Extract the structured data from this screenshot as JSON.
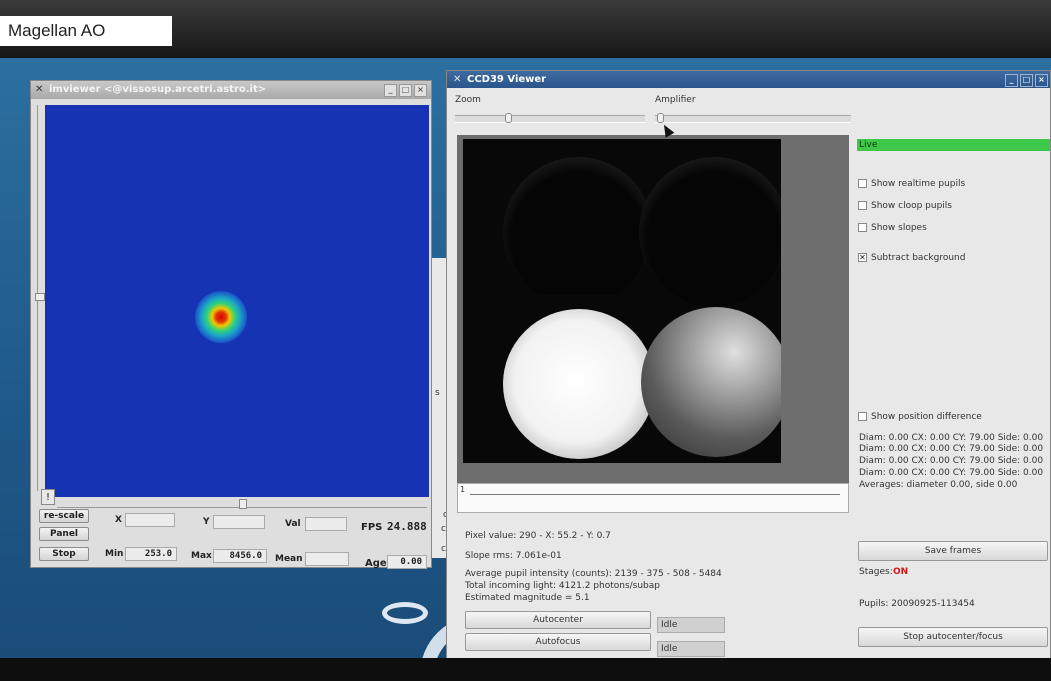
{
  "top_label": "Magellan AO",
  "imviewer": {
    "title": "imviewer <@vissosup.arcetri.astro.it>",
    "up_button": "!",
    "buttons": {
      "rescale": "re-scale",
      "panel": "Panel",
      "stop": "Stop"
    },
    "labels": {
      "x": "X",
      "y": "Y",
      "val": "Val",
      "fps": "FPS",
      "min": "Min",
      "max": "Max",
      "mean": "Mean",
      "age": "Age"
    },
    "values": {
      "fps": "24.888",
      "min": "253.0",
      "max": "8456.0",
      "age": "0.00",
      "x": "",
      "y": "",
      "val": "",
      "mean": ""
    }
  },
  "background_window": {
    "fragments": [
      "s",
      "cd",
      "cus",
      "cus"
    ]
  },
  "ccd39": {
    "title": "CCD39 Viewer",
    "zoom_label": "Zoom",
    "amplifier_label": "Amplifier",
    "plot_ticks": "1",
    "live": "Live",
    "checkboxes": [
      {
        "label": "Show realtime pupils",
        "checked": ""
      },
      {
        "label": "Show cloop pupils",
        "checked": ""
      },
      {
        "label": "Show slopes",
        "checked": ""
      },
      {
        "label": "Subtract background",
        "checked": "✕"
      },
      {
        "label": "Show position difference",
        "checked": ""
      }
    ],
    "diam_rows": [
      "Diam:  0.00 CX:  0.00  CY: 79.00 Side: 0.00",
      "Diam:  0.00 CX:  0.00  CY: 79.00 Side: 0.00",
      "Diam:  0.00 CX:  0.00  CY: 79.00 Side: 0.00",
      "Diam:  0.00 CX:  0.00  CY: 79.00 Side: 0.00"
    ],
    "averages": "Averages: diameter  0.00, side  0.00",
    "pixel_value": "Pixel value: 290 - X:  55.2 - Y:   0.7",
    "slope_rms": "Slope rms: 7.061e-01",
    "avg_intensity": "Average pupil intensity (counts): 2139 - 375 - 508 - 5484",
    "total_light": "Total incoming light: 4121.2 photons/subap",
    "magnitude": "Estimated magnitude =   5.1",
    "autocenter_btn": "Autocenter",
    "autocenter_status": "Idle",
    "autofocus_btn": "Autofocus",
    "autofocus_status": "Idle",
    "save_frames_btn": "Save frames",
    "stages_label": "Stages:",
    "stages_value": "ON",
    "stages_color": "#d01818",
    "pupils": "Pupils: 20090925-113454",
    "stop_btn": "Stop autocenter/focus"
  }
}
